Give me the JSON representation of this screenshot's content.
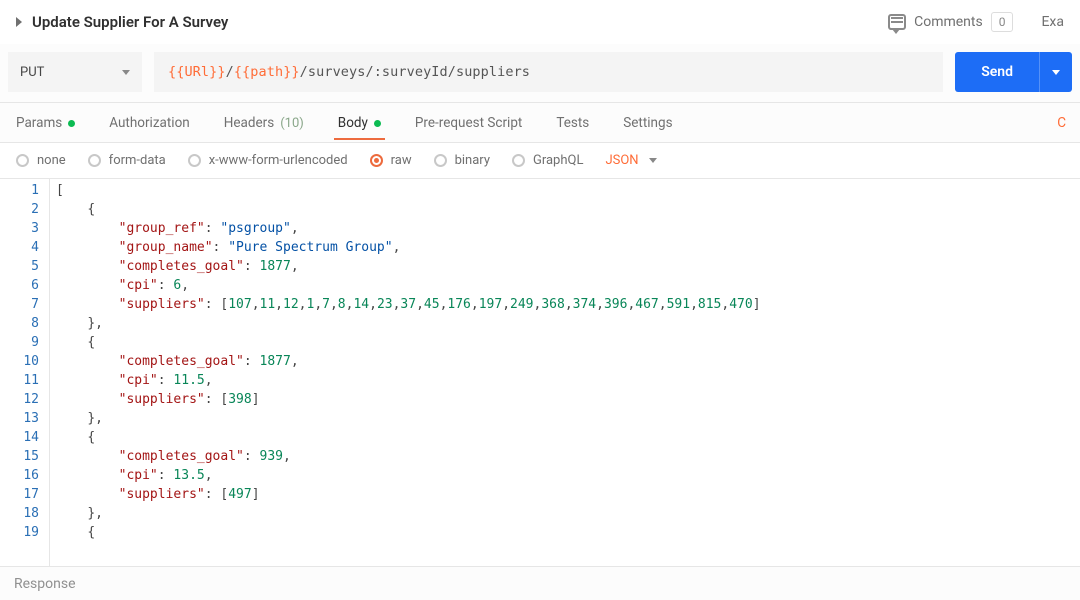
{
  "header": {
    "title": "Update Supplier For A Survey",
    "comments_label": "Comments",
    "comments_count": "0",
    "trailing": "Exa"
  },
  "request": {
    "method": "PUT",
    "url": {
      "var1": "{{URl}}",
      "sep1": "/",
      "var2": "{{path}}",
      "rest": "/surveys/:surveyId/suppliers"
    },
    "send_label": "Send"
  },
  "tabs": {
    "params": "Params",
    "authorization": "Authorization",
    "headers": "Headers",
    "headers_count": "(10)",
    "body": "Body",
    "prerequest": "Pre-request Script",
    "tests": "Tests",
    "settings": "Settings"
  },
  "body_types": {
    "none": "none",
    "formdata": "form-data",
    "xwww": "x-www-form-urlencoded",
    "raw": "raw",
    "binary": "binary",
    "graphql": "GraphQL",
    "mime": "JSON"
  },
  "editor": {
    "lines": [
      "1",
      "2",
      "3",
      "4",
      "5",
      "6",
      "7",
      "8",
      "9",
      "10",
      "11",
      "12",
      "13",
      "14",
      "15",
      "16",
      "17",
      "18",
      "19"
    ],
    "body_json": [
      {
        "group_ref": "psgroup",
        "group_name": "Pure Spectrum Group",
        "completes_goal": 1877,
        "cpi": 6,
        "suppliers": [
          107,
          11,
          12,
          1,
          7,
          8,
          14,
          23,
          37,
          45,
          176,
          197,
          249,
          368,
          374,
          396,
          467,
          591,
          815,
          470
        ]
      },
      {
        "completes_goal": 1877,
        "cpi": 11.5,
        "suppliers": [
          398
        ]
      },
      {
        "completes_goal": 939,
        "cpi": 13.5,
        "suppliers": [
          497
        ]
      }
    ]
  },
  "response_label": "Response"
}
